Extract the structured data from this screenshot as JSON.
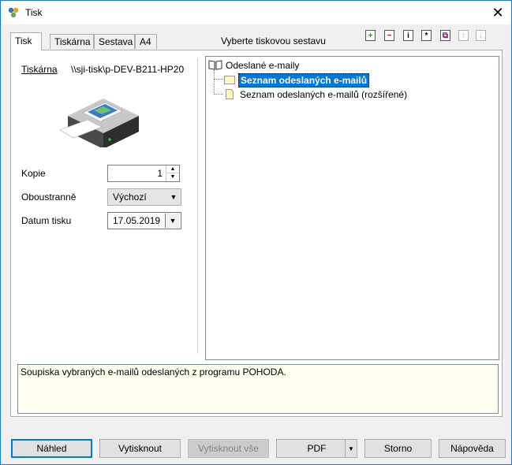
{
  "window": {
    "title": "Tisk",
    "close_glyph": "✕"
  },
  "tabs": [
    {
      "label": "Tisk",
      "active": true
    },
    {
      "label": "Tiskárna",
      "active": false
    },
    {
      "label": "Sestava",
      "active": false
    },
    {
      "label": "A4",
      "active": false
    }
  ],
  "left": {
    "printer_label": "Tiskárna",
    "printer_path": "\\\\sji-tisk\\p-DEV-B211-HP20",
    "copies_label": "Kopie",
    "copies_value": "1",
    "duplex_label": "Oboustranně",
    "duplex_value": "Výchozí",
    "date_label": "Datum tisku",
    "date_value": "17.05.2019"
  },
  "right": {
    "heading": "Vyberte tiskovou sestavu",
    "toolbar": [
      {
        "icon": "add-icon",
        "glyph": "+",
        "color": "#1a9c1a",
        "disabled": false
      },
      {
        "icon": "remove-icon",
        "glyph": "−",
        "color": "#d01010",
        "disabled": false
      },
      {
        "icon": "info-icon",
        "glyph": "i",
        "color": "#000000",
        "disabled": false
      },
      {
        "icon": "asterisk-icon",
        "glyph": "*",
        "color": "#000000",
        "disabled": false
      },
      {
        "icon": "copy-icon",
        "glyph": "⧉",
        "color": "#8a1a8a",
        "disabled": false
      },
      {
        "icon": "move-up-icon",
        "glyph": "↑",
        "color": "#b0b0b0",
        "disabled": true
      },
      {
        "icon": "move-down-icon",
        "glyph": "↓",
        "color": "#b0b0b0",
        "disabled": true
      }
    ],
    "tree": {
      "root": "Odeslané e-maily",
      "children": [
        {
          "label": "Seznam odeslaných e-mailů",
          "selected": true
        },
        {
          "label": "Seznam odeslaných e-mailů (rozšířené)",
          "selected": false
        }
      ]
    }
  },
  "description": "Soupiska vybraných e-mailů odeslaných z programu POHODA.",
  "buttons": {
    "preview": "Náhled",
    "print": "Vytisknout",
    "print_all": "Vytisknout vše",
    "pdf": "PDF",
    "cancel": "Storno",
    "help": "Nápověda"
  },
  "colors": {
    "accent": "#0078d7",
    "selection": "#0078d7",
    "description_bg": "#fffff0"
  }
}
